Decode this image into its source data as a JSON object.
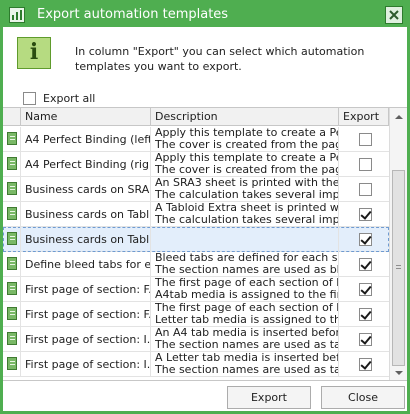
{
  "window": {
    "title": "Export automation templates",
    "accent_color": "#4fae50",
    "app_icon": "automation-templates-icon",
    "close_icon": "close-icon"
  },
  "info": {
    "icon": "info-icon",
    "icon_glyph": "i",
    "text": "In column \"Export\" you can select which automation templates you want to export."
  },
  "export_all": {
    "label": "Export all",
    "checked": false
  },
  "grid": {
    "columns": {
      "name": "Name",
      "description": "Description",
      "export": "Export"
    },
    "rows": [
      {
        "name": "A4 Perfect Binding (left...",
        "desc1": "Apply this template to create a Perf...",
        "desc2": "The cover is created from the pages...",
        "export": false,
        "selected": false
      },
      {
        "name": "A4 Perfect Binding (rig...",
        "desc1": "Apply this template to create a Perf...",
        "desc2": "The cover is created from the pages...",
        "export": false,
        "selected": false
      },
      {
        "name": "Business cards on SRA3",
        "desc1": "An SRA3 sheet is printed with the m...",
        "desc2": "The calculation takes several imposi...",
        "export": false,
        "selected": false
      },
      {
        "name": "Business cards on Tabl...",
        "desc1": "A Tabloid Extra sheet is printed wit...",
        "desc2": "The calculation takes several imposi...",
        "export": true,
        "selected": false
      },
      {
        "name": "Business cards on Tabl...",
        "desc1": "",
        "desc2": "",
        "export": true,
        "selected": true
      },
      {
        "name": "Define bleed tabs for e...",
        "desc1": "Bleed tabs are defined for each sect...",
        "desc2": "The section names are used as blee...",
        "export": true,
        "selected": false
      },
      {
        "name": "First page of section: F...",
        "desc1": "The first page of each section of lev...",
        "desc2": "A4tab media is assigned to the first...",
        "export": true,
        "selected": false
      },
      {
        "name": "First page of section: F...",
        "desc1": "The first page of each section of lev...",
        "desc2": "Letter tab media is assigned to the f...",
        "export": true,
        "selected": false
      },
      {
        "name": "First page of section: I...",
        "desc1": "An A4 tab media is inserted before t...",
        "desc2": "The section names are used as tab t...",
        "export": true,
        "selected": false
      },
      {
        "name": "First page of section: I...",
        "desc1": "A Letter tab media is inserted befor...",
        "desc2": "The section names are used as tab t...",
        "export": true,
        "selected": false
      }
    ]
  },
  "scrollbar": {
    "up_icon": "scroll-up-arrow-icon",
    "down_icon": "scroll-down-arrow-icon"
  },
  "buttons": {
    "export": "Export",
    "close": "Close"
  }
}
